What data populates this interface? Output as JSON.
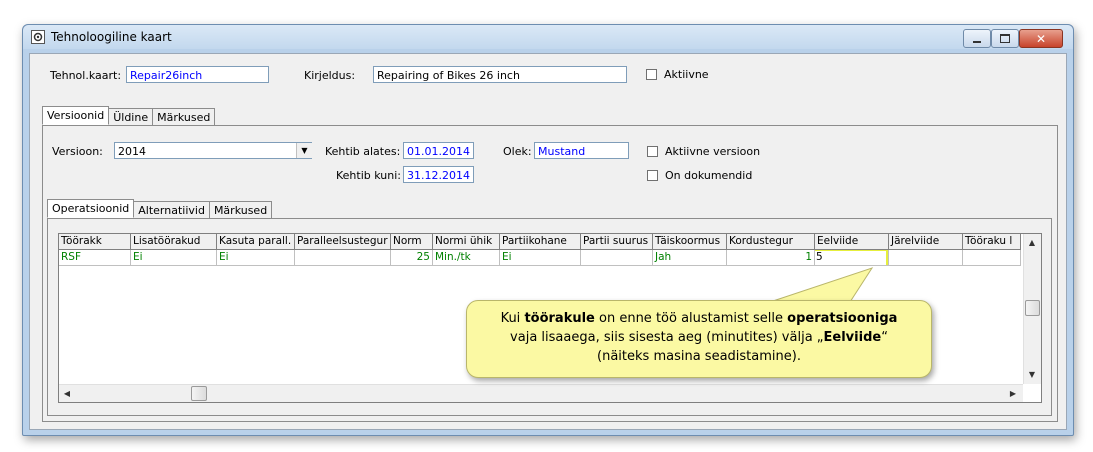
{
  "window": {
    "title": "Tehnoloogiline kaart",
    "minimize_icon": "minimize-icon",
    "maximize_icon": "maximize-icon",
    "close_icon": "close-icon"
  },
  "header": {
    "tehnkaart_label": "Tehnol.kaart:",
    "tehnkaart_value": "Repair26inch",
    "kirjeldus_label": "Kirjeldus:",
    "kirjeldus_value": "Repairing of Bikes 26 inch",
    "aktiivne_label": "Aktiivne"
  },
  "main_tabs": [
    "Versioonid",
    "Üldine",
    "Märkused"
  ],
  "version": {
    "version_label": "Versioon:",
    "version_value": "2014",
    "kehtib_alates_label": "Kehtib alates:",
    "kehtib_alates_value": "01.01.2014",
    "kehtib_kuni_label": "Kehtib kuni:",
    "kehtib_kuni_value": "31.12.2014",
    "olek_label": "Olek:",
    "olek_value": "Mustand",
    "aktiivne_versioon_label": "Aktiivne versioon",
    "on_dokumendid_label": "On dokumendid"
  },
  "sub_tabs": [
    "Operatsioonid",
    "Alternatiivid",
    "Märkused"
  ],
  "table": {
    "columns": [
      "Töörakk",
      "Lisatöörakud",
      "Kasuta parall.",
      "Paralleelsustegur",
      "Norm",
      "Normi ühik",
      "Partiikohane",
      "Partii suurus",
      "Täiskoormus",
      "Kordustegur",
      "Eelviide",
      "Järelviide",
      "Tööraku l"
    ],
    "rows": [
      [
        "RSF",
        "Ei",
        "Ei",
        "",
        "25",
        "Min./tk",
        "Ei",
        "",
        "Jah",
        "1",
        "5",
        "",
        ""
      ]
    ]
  },
  "callout": {
    "p1": "Kui ",
    "b1": "töörakule",
    "p2": " on enne töö alustamist selle ",
    "b2": "operatsiooniga",
    "p3": "vaja lisaaega, siis sisesta aeg (minutites) välja „",
    "b3": "Eelviide",
    "p4": "“",
    "p5": "(näiteks masina seadistamine)."
  },
  "colors": {
    "highlight": "#e6ef3c",
    "callout_bg": "#fbf9a3",
    "value_blue": "#0000ff",
    "value_green": "#008000"
  }
}
